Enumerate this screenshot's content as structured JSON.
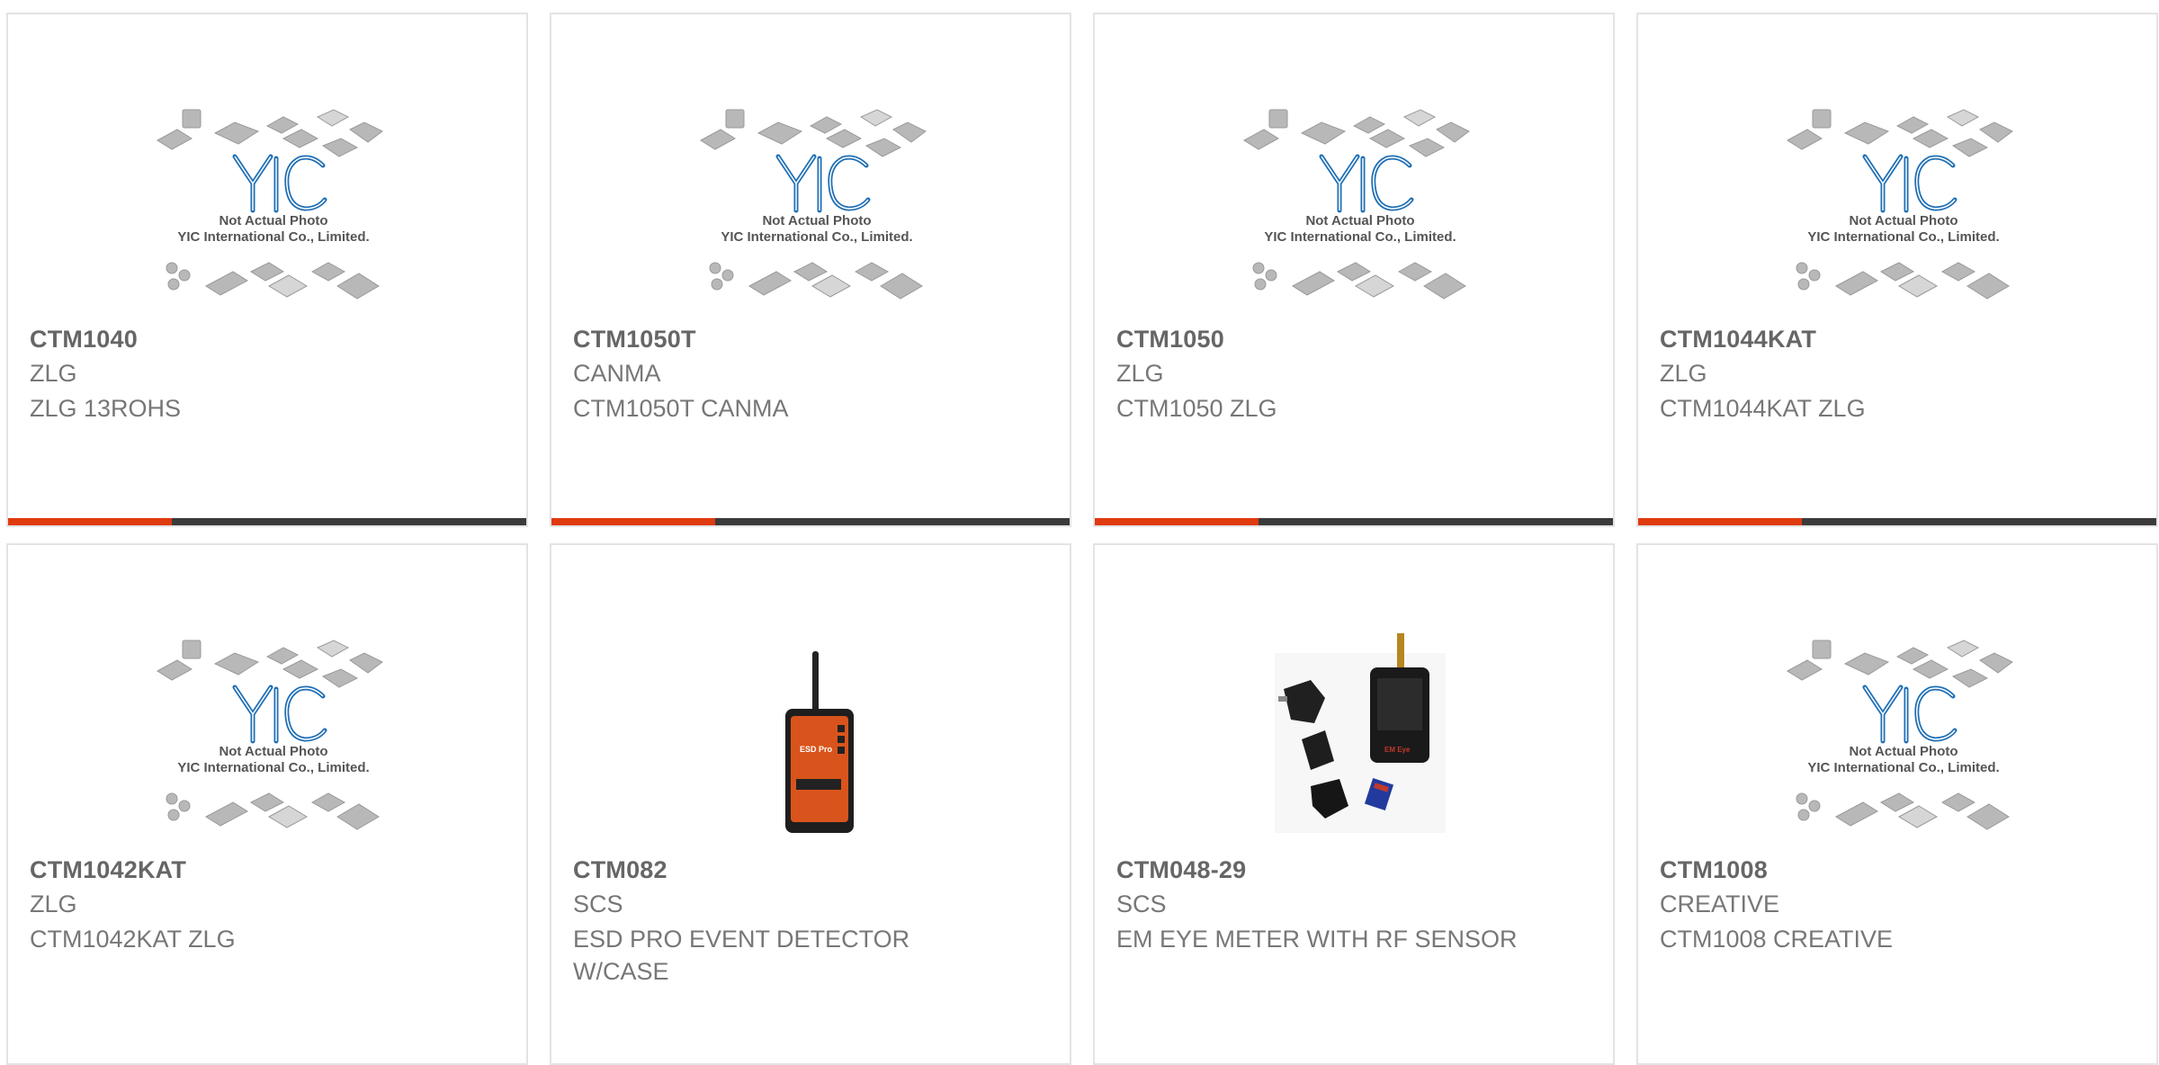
{
  "colors": {
    "accent": "#e03a0f",
    "bar": "#3b3b3b",
    "border": "#e3e3e3",
    "yic_blue": "#1f6fb5"
  },
  "placeholder": {
    "logo_text": "YIC",
    "line1": "Not Actual Photo",
    "line2": "YIC International Co., Limited."
  },
  "products": [
    {
      "part": "CTM1040",
      "manufacturer": "ZLG",
      "description": "ZLG 13ROHS",
      "image": "placeholder"
    },
    {
      "part": "CTM1050T",
      "manufacturer": "CANMA",
      "description": "CTM1050T CANMA",
      "image": "placeholder"
    },
    {
      "part": "CTM1050",
      "manufacturer": "ZLG",
      "description": "CTM1050 ZLG",
      "image": "placeholder"
    },
    {
      "part": "CTM1044KAT",
      "manufacturer": "ZLG",
      "description": "CTM1044KAT ZLG",
      "image": "placeholder"
    },
    {
      "part": "CTM1042KAT",
      "manufacturer": "ZLG",
      "description": "CTM1042KAT ZLG",
      "image": "placeholder"
    },
    {
      "part": "CTM082",
      "manufacturer": "SCS",
      "description": "ESD PRO EVENT DETECTOR W/CASE",
      "image": "esd-detector-photo"
    },
    {
      "part": "CTM048-29",
      "manufacturer": "SCS",
      "description": "EM EYE METER WITH RF SENSOR",
      "image": "em-eye-meter-photo",
      "device_label": "EM Eye"
    },
    {
      "part": "CTM1008",
      "manufacturer": "CREATIVE",
      "description": "CTM1008 CREATIVE",
      "image": "placeholder"
    }
  ]
}
